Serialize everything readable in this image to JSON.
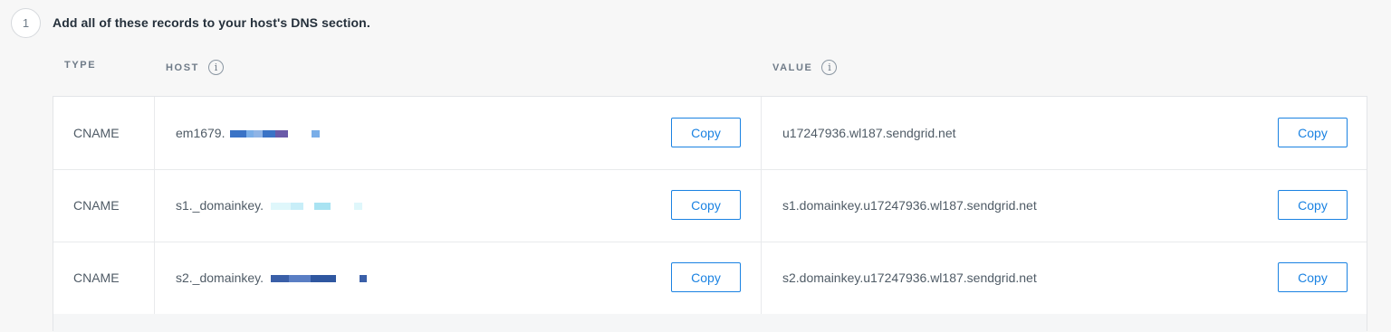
{
  "step": {
    "number": "1",
    "instruction": "Add all of these records to your host's DNS section."
  },
  "columns": {
    "type": "TYPE",
    "host": "HOST",
    "value": "VALUE",
    "info_glyph": "i"
  },
  "records": [
    {
      "type": "CNAME",
      "host": "em1679.",
      "value": "u17247936.wl187.sendgrid.net",
      "copy_label": "Copy"
    },
    {
      "type": "CNAME",
      "host": "s1._domainkey.",
      "value": "s1.domainkey.u17247936.wl187.sendgrid.net",
      "copy_label": "Copy"
    },
    {
      "type": "CNAME",
      "host": "s2._domainkey.",
      "value": "s2.domainkey.u17247936.wl187.sendgrid.net",
      "copy_label": "Copy"
    }
  ],
  "colors": {
    "accent": "#1a82e2",
    "redact_row1": [
      "#3a73c6",
      "#7aaee8",
      "#8fb4e6",
      "#6a5aa8"
    ],
    "redact_row2": [
      "#dff7fb",
      "#c8eef8",
      "#a9e3f2"
    ],
    "redact_row3": [
      "#3a5fa8",
      "#5a7ec4",
      "#2f57a0"
    ]
  },
  "icons": {
    "host_info": "info-icon",
    "value_info": "info-icon"
  }
}
